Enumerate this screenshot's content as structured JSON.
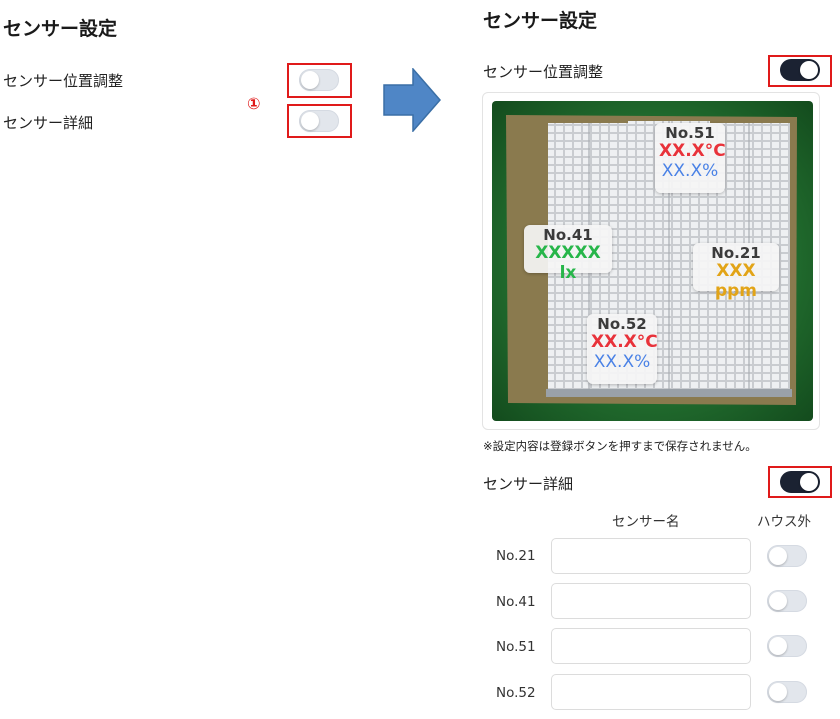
{
  "left_panel": {
    "title": "センサー設定",
    "position_label": "センサー位置調整",
    "detail_label": "センサー詳細",
    "marker": "①",
    "position_toggle_on": false,
    "detail_toggle_on": false
  },
  "right_panel": {
    "title": "センサー設定",
    "position_label": "センサー位置調整",
    "position_toggle_on": true,
    "map_sensors": [
      {
        "no": "No.51",
        "temp": "XX.X°C",
        "humidity": "XX.X%"
      },
      {
        "no": "No.41",
        "light": "XXXXX lx"
      },
      {
        "no": "No.21",
        "co2": "XXX ppm"
      },
      {
        "no": "No.52",
        "temp": "XX.X°C",
        "humidity": "XX.X%"
      }
    ],
    "note": "※設定内容は登録ボタンを押すまで保存されません。",
    "detail_label": "センサー詳細",
    "detail_toggle_on": true,
    "table": {
      "col_name": "センサー名",
      "col_outside": "ハウス外",
      "rows": [
        {
          "label": "No.21",
          "name": "",
          "outside": false
        },
        {
          "label": "No.41",
          "name": "",
          "outside": false
        },
        {
          "label": "No.51",
          "name": "",
          "outside": false
        },
        {
          "label": "No.52",
          "name": "",
          "outside": false
        }
      ]
    }
  },
  "colors": {
    "accent_red": "#e01a1a",
    "toggle_on": "#1b2232",
    "toggle_off": "#e2e6ec",
    "temp": "#e8323a",
    "humidity": "#4a82e6",
    "light": "#27b64a",
    "co2": "#e2a417",
    "arrow": "#4f86c6"
  },
  "icons": [
    "right-arrow-icon"
  ]
}
